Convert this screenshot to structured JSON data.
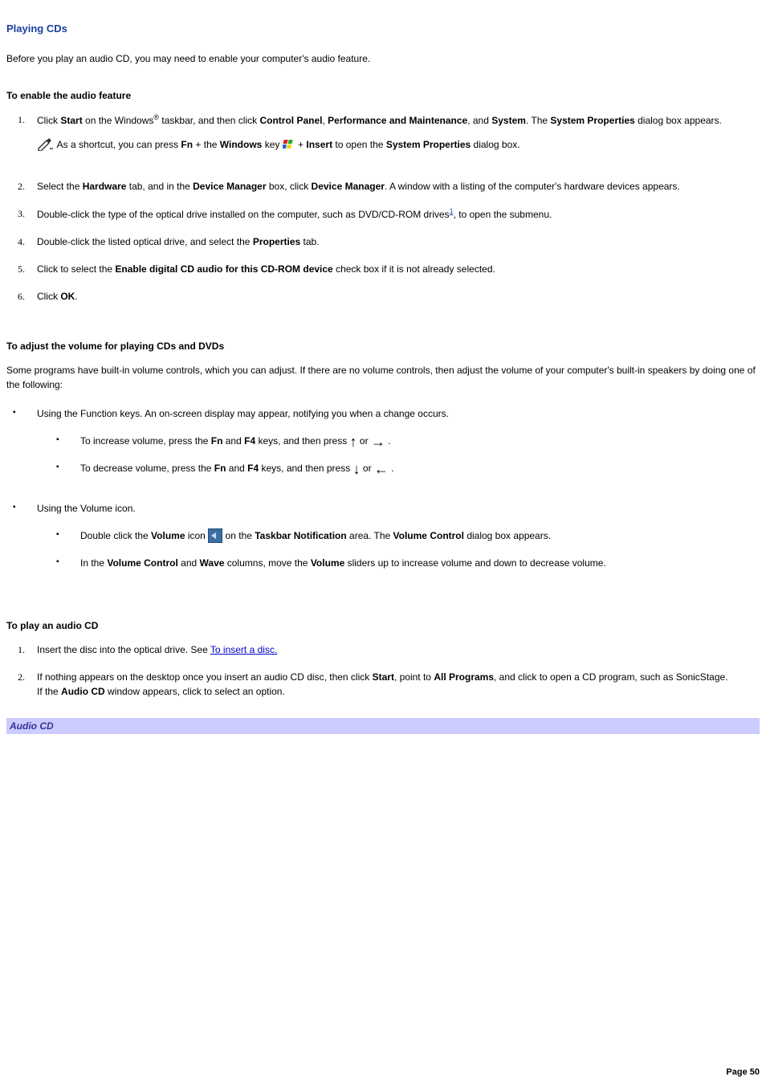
{
  "page_title": "Playing CDs",
  "intro": "Before you play an audio CD, you may need to enable your computer's audio feature.",
  "section1": {
    "heading": "To enable the audio feature",
    "steps": [
      {
        "num": "1.",
        "pre": "Click ",
        "b1": "Start",
        "mid1": " on the Windows",
        "reg": "®",
        "mid2": " taskbar, and then click ",
        "b2": "Control Panel",
        "sep1": ", ",
        "b3": "Performance and Maintenance",
        "sep2": ", and ",
        "b4": "System",
        "post1": ". The ",
        "b5": "System Properties",
        "post2": " dialog box appears."
      },
      {
        "num": "2.",
        "pre": "Select the ",
        "b1": "Hardware",
        "mid1": " tab, and in the ",
        "b2": "Device Manager",
        "mid2": " box, click ",
        "b3": "Device Manager",
        "post": ". A window with a listing of the computer's hardware devices appears."
      },
      {
        "num": "3.",
        "pre": "Double-click the type of the optical drive installed on the computer, such as DVD/CD-ROM drives",
        "fn": "1",
        "post": ", to open the submenu."
      },
      {
        "num": "4.",
        "pre": "Double-click the listed optical drive, and select the ",
        "b1": "Properties",
        "post": " tab."
      },
      {
        "num": "5.",
        "pre": "Click to select the ",
        "b1": "Enable digital CD audio for this CD-ROM device",
        "post": " check box if it is not already selected."
      },
      {
        "num": "6.",
        "pre": "Click ",
        "b1": "OK",
        "post": "."
      }
    ],
    "note": {
      "pre": " As a shortcut, you can press ",
      "b1": "Fn",
      "mid1": " + the ",
      "b2": "Windows",
      "mid2": " key ",
      "mid3": " + ",
      "b3": "Insert",
      "mid4": " to open the ",
      "b4": "System Properties",
      "post": " dialog box."
    }
  },
  "section2": {
    "heading": "To adjust the volume for playing CDs and DVDs",
    "intro": "Some programs have built-in volume controls, which you can adjust. If there are no volume controls, then adjust the volume of your computer's built-in speakers by doing one of the following:",
    "bullets": {
      "fn_keys": "Using the Function keys. An on-screen display may appear, notifying you when a change occurs.",
      "increase": {
        "pre": "To increase volume, press the ",
        "b1": "Fn",
        "mid1": " and ",
        "b2": "F4",
        "mid2": " keys, and then press ",
        "or": " or ",
        "post": " ."
      },
      "decrease": {
        "pre": "To decrease volume, press the ",
        "b1": "Fn",
        "mid1": " and ",
        "b2": "F4",
        "mid2": " keys, and then press ",
        "or": " or ",
        "post": " ."
      },
      "vol_icon_intro": "Using the Volume icon.",
      "vol_dbl": {
        "pre": "Double click the ",
        "b1": "Volume",
        "mid1": " icon ",
        "mid2": " on the ",
        "b2": "Taskbar Notification",
        "mid3": " area. The ",
        "b3": "Volume Control",
        "post": " dialog box appears."
      },
      "vol_sliders": {
        "pre": "In the ",
        "b1": "Volume Control",
        "mid1": " and ",
        "b2": "Wave",
        "mid2": " columns, move the ",
        "b3": "Volume",
        "post": " sliders up to increase volume and down to decrease volume."
      }
    }
  },
  "section3": {
    "heading": "To play an audio CD",
    "steps": [
      {
        "num": "1.",
        "pre": "Insert the disc into the optical drive. See ",
        "link": "To insert a disc."
      },
      {
        "num": "2.",
        "pre": "If nothing appears on the desktop once you insert an audio CD disc, then click ",
        "b1": "Start",
        "mid1": ", point to ",
        "b2": "All Programs",
        "mid2": ", and click to open a CD program, such as SonicStage.",
        "line2a": "If the ",
        "b3": "Audio CD",
        "line2b": " window appears, click to select an option."
      }
    ]
  },
  "caption": "Audio CD",
  "page_number": "Page 50"
}
